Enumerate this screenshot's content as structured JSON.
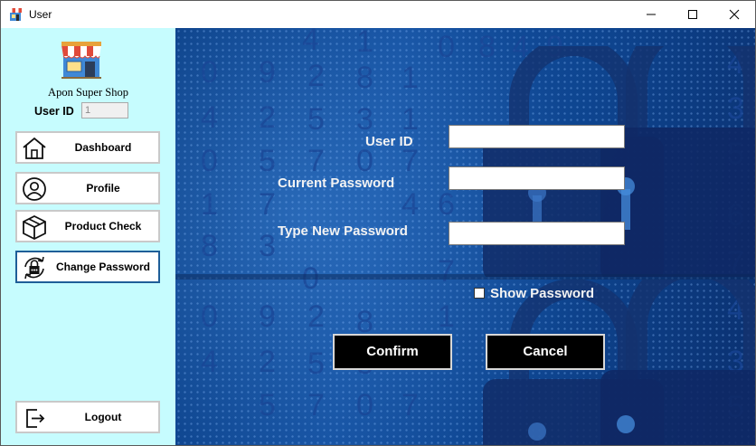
{
  "window": {
    "title": "User",
    "icon": "shop-icon"
  },
  "sidebar": {
    "shop_name": "Apon Super Shop",
    "user_id_label": "User ID",
    "user_id_value": "1",
    "items": [
      {
        "label": "Dashboard",
        "icon": "home-icon"
      },
      {
        "label": "Profile",
        "icon": "user-icon"
      },
      {
        "label": "Product Check",
        "icon": "box-icon"
      },
      {
        "label": "Change Password",
        "icon": "lock-icon",
        "active": true
      }
    ],
    "logout_label": "Logout"
  },
  "form": {
    "user_id_label": "User ID",
    "current_password_label": "Current Password",
    "new_password_label": "Type New Password",
    "user_id_value": "",
    "current_password_value": "",
    "new_password_value": "",
    "show_password_label": "Show Password",
    "show_password_checked": false,
    "confirm_label": "Confirm",
    "cancel_label": "Cancel"
  },
  "colors": {
    "sidebar_bg": "#c6fcfe",
    "active_border": "#1e5e98",
    "content_bg": "#0e4590",
    "button_bg": "#000000"
  }
}
